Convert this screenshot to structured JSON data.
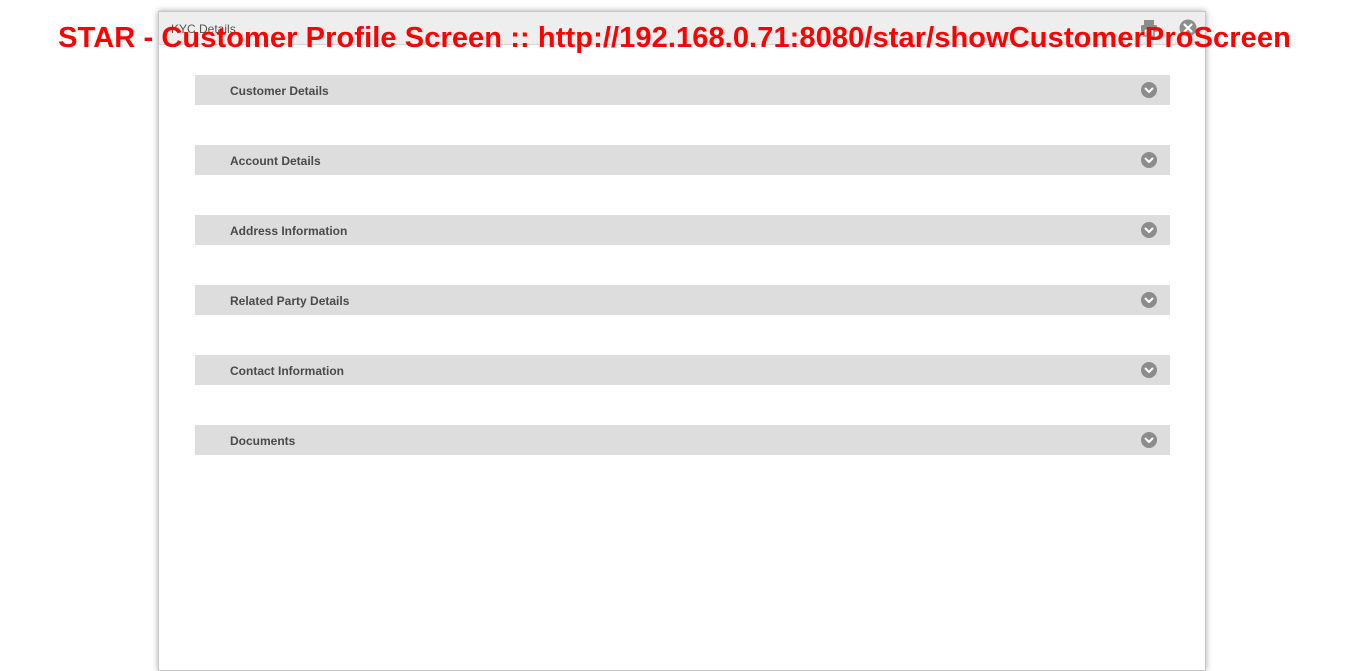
{
  "banner": {
    "text": "STAR - Customer Profile Screen :: http://192.168.0.71:8080/star/showCustomerProScreen"
  },
  "modal": {
    "title": "KYC Details",
    "print_icon": "print-icon",
    "close_icon": "close-icon"
  },
  "sections": [
    {
      "label": "Customer Details",
      "icon": "chevron-down-icon"
    },
    {
      "label": "Account Details",
      "icon": "chevron-down-icon"
    },
    {
      "label": "Address Information",
      "icon": "chevron-down-icon"
    },
    {
      "label": "Related Party Details",
      "icon": "chevron-down-icon"
    },
    {
      "label": "Contact Information",
      "icon": "chevron-down-icon"
    },
    {
      "label": "Documents",
      "icon": "chevron-down-icon"
    }
  ],
  "colors": {
    "banner": "#ff0000",
    "section_bg": "#dddddd",
    "icon_gray": "#8c8c8c"
  }
}
